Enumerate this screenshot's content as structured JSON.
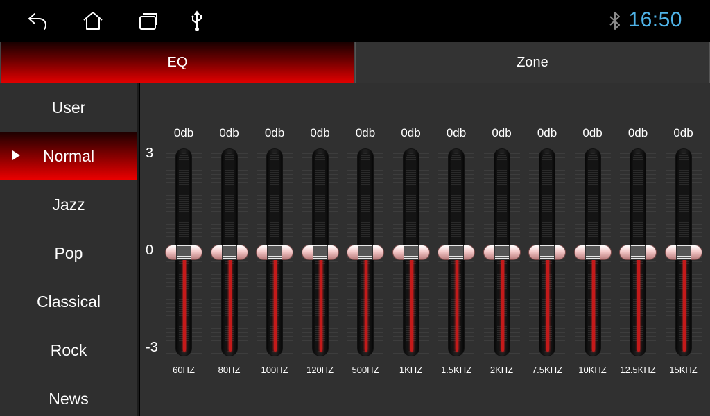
{
  "statusbar": {
    "icons": [
      "back-icon",
      "home-icon",
      "recent-apps-icon",
      "usb-icon",
      "bluetooth-icon"
    ],
    "clock": "16:50",
    "clock_color": "#4fb3e8"
  },
  "tabs": [
    {
      "label": "EQ",
      "active": true
    },
    {
      "label": "Zone",
      "active": false
    }
  ],
  "presets": [
    {
      "label": "User",
      "active": false
    },
    {
      "label": "Normal",
      "active": true
    },
    {
      "label": "Jazz",
      "active": false
    },
    {
      "label": "Pop",
      "active": false
    },
    {
      "label": "Classical",
      "active": false
    },
    {
      "label": "Rock",
      "active": false
    },
    {
      "label": "News",
      "active": false
    }
  ],
  "scale": {
    "max": "3",
    "mid": "0",
    "min": "-3"
  },
  "bands": [
    {
      "freq": "60HZ",
      "db_label": "0db",
      "value": 0
    },
    {
      "freq": "80HZ",
      "db_label": "0db",
      "value": 0
    },
    {
      "freq": "100HZ",
      "db_label": "0db",
      "value": 0
    },
    {
      "freq": "120HZ",
      "db_label": "0db",
      "value": 0
    },
    {
      "freq": "500HZ",
      "db_label": "0db",
      "value": 0
    },
    {
      "freq": "1KHZ",
      "db_label": "0db",
      "value": 0
    },
    {
      "freq": "1.5KHZ",
      "db_label": "0db",
      "value": 0
    },
    {
      "freq": "2KHZ",
      "db_label": "0db",
      "value": 0
    },
    {
      "freq": "7.5KHZ",
      "db_label": "0db",
      "value": 0
    },
    {
      "freq": "10KHZ",
      "db_label": "0db",
      "value": 0
    },
    {
      "freq": "12.5KHZ",
      "db_label": "0db",
      "value": 0
    },
    {
      "freq": "15KHZ",
      "db_label": "0db",
      "value": 0
    }
  ],
  "colors": {
    "accent": "#e00000",
    "fill": "#c41a1a",
    "panel": "#303030"
  }
}
